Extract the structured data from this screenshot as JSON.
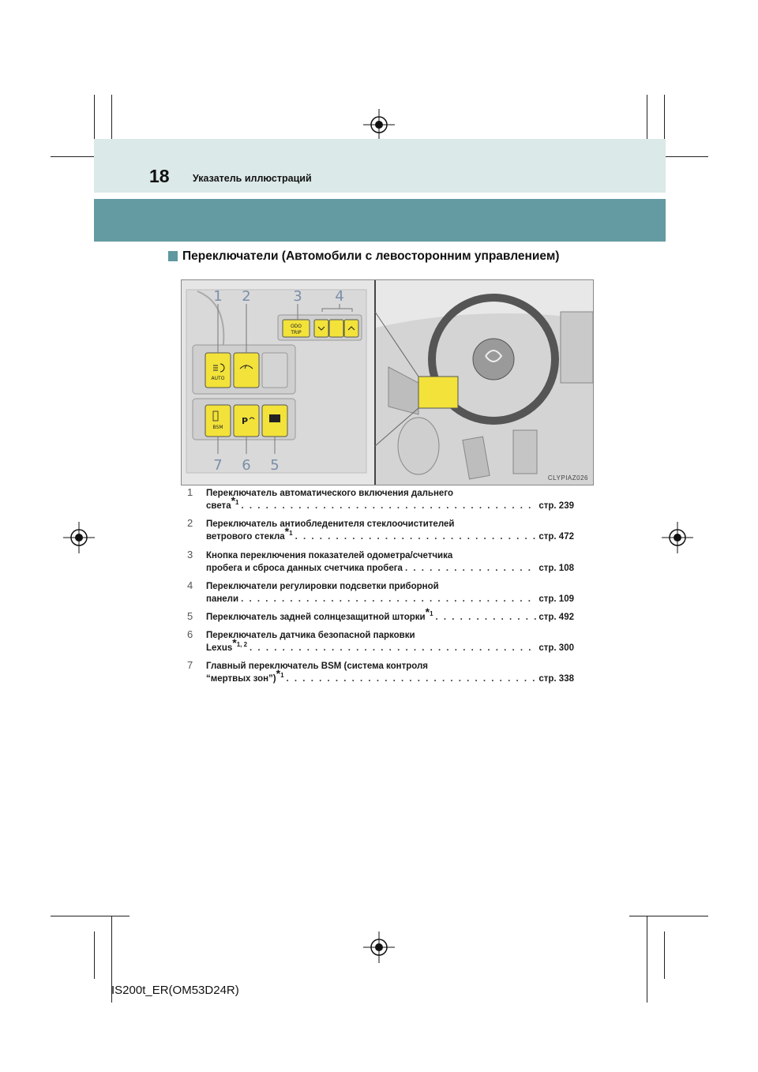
{
  "header": {
    "page_number": "18",
    "title": "Указатель иллюстраций"
  },
  "section": {
    "title": "Переключатели (Автомобили с левосторонним управлением)"
  },
  "illustration": {
    "code": "CLYPIAZ026",
    "callouts": [
      "1",
      "2",
      "3",
      "4",
      "5",
      "6",
      "7"
    ],
    "switch_labels": {
      "auto": "AUTO",
      "bsm": "BSM",
      "odo": "ODO",
      "trip": "TRIP"
    }
  },
  "items": [
    {
      "num": "1",
      "line1": "Переключатель автоматического включения дальнего",
      "line2": "света",
      "sup": "1",
      "page": "стр. 239"
    },
    {
      "num": "2",
      "line1": "Переключатель антиобледенителя стеклоочистителей",
      "line2": "ветрового стекла",
      "sup": "1",
      "page": "стр. 472"
    },
    {
      "num": "3",
      "line1": "Кнопка переключения показателей одометра/счетчика",
      "line2": "пробега и сброса данных счетчика пробега",
      "sup": "",
      "page": "стр. 108"
    },
    {
      "num": "4",
      "line1": "Переключатели регулировки подсветки приборной",
      "line2": "панели",
      "sup": "",
      "page": "стр. 109"
    },
    {
      "num": "5",
      "line1": "",
      "line2": "Переключатель задней солнцезащитной шторки",
      "sup": "1",
      "page": "стр. 492"
    },
    {
      "num": "6",
      "line1": "Переключатель датчика безопасной парковки",
      "line2": "Lexus",
      "sup": "1, 2",
      "page": "стр. 300"
    },
    {
      "num": "7",
      "line1": "Главный переключатель BSM (система контроля",
      "line2": "“мертвых зон”)",
      "sup": "1",
      "page": "стр. 338"
    }
  ],
  "footer": {
    "code": "IS200t_ER(OM53D24R)"
  }
}
